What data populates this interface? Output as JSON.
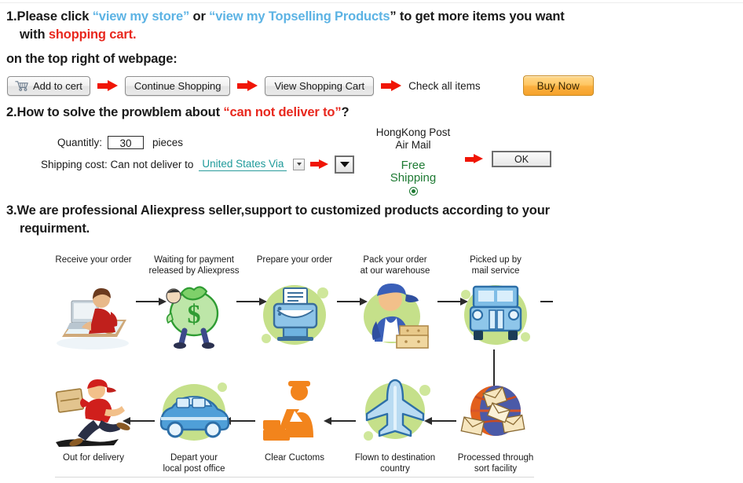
{
  "section1": {
    "line1_prefix": "1.Please click ",
    "link1": "“view my store”",
    "line1_mid": " or ",
    "link2": "“view my Topselling Products",
    "line1_suffix": "” to get more items you want",
    "line2_prefix": "with ",
    "line2_red": "shopping cart.",
    "line3": "on the top right of webpage:"
  },
  "buttons": {
    "add_to_cart": "Add to cert",
    "continue_shopping": "Continue Shopping",
    "view_cart": "View Shopping Cart",
    "check_all_items": "Check all items",
    "buy_now": "Buy Now"
  },
  "section2": {
    "heading_prefix": "2.How to solve the prowblem about ",
    "heading_red": "“can not deliver to”",
    "heading_suffix": "?",
    "quantity_label": "Quantitly:",
    "quantity_value": "30",
    "pieces_label": "pieces",
    "shipping_label": "Shipping cost: Can not deliver to",
    "country_value": "United States Via",
    "carrier_line1": "HongKong Post",
    "carrier_line2": "Air Mail",
    "free_line1": "Free",
    "free_line2": "Shipping",
    "ok_label": "OK"
  },
  "section3": {
    "line1": "3.We are professional Aliexpress seller,support to customized products according to your",
    "line2": "requirment."
  },
  "flow": {
    "top_row": [
      {
        "caption": "Receive your order",
        "icon": "person-at-computer-icon"
      },
      {
        "caption": "Waiting for payment\nreleased by Aliexpress",
        "icon": "money-bag-icon"
      },
      {
        "caption": "Prepare your order",
        "icon": "printer-icon"
      },
      {
        "caption": "Pack your order\nat our warehouse",
        "icon": "worker-with-boxes-icon"
      },
      {
        "caption": "Picked up by\nmail service",
        "icon": "truck-icon"
      }
    ],
    "bottom_row": [
      {
        "caption": "Out for delivery",
        "icon": "courier-running-icon"
      },
      {
        "caption": "Depart your\nlocal post office",
        "icon": "delivery-van-icon"
      },
      {
        "caption": "Clear Cuctoms",
        "icon": "customs-officer-icon"
      },
      {
        "caption": "Flown to destination\ncountry",
        "icon": "airplane-icon"
      },
      {
        "caption": "Processed through\nsort facility",
        "icon": "globe-mail-icon"
      }
    ]
  },
  "colors": {
    "link_blue": "#5cb3e4",
    "alert_red": "#e8281e",
    "arrow_red": "#f01505",
    "country_teal": "#1f9a9a",
    "free_green": "#1e7a33",
    "buy_now_orange": "#fbb03f",
    "blob_green": "#c5e08a"
  }
}
